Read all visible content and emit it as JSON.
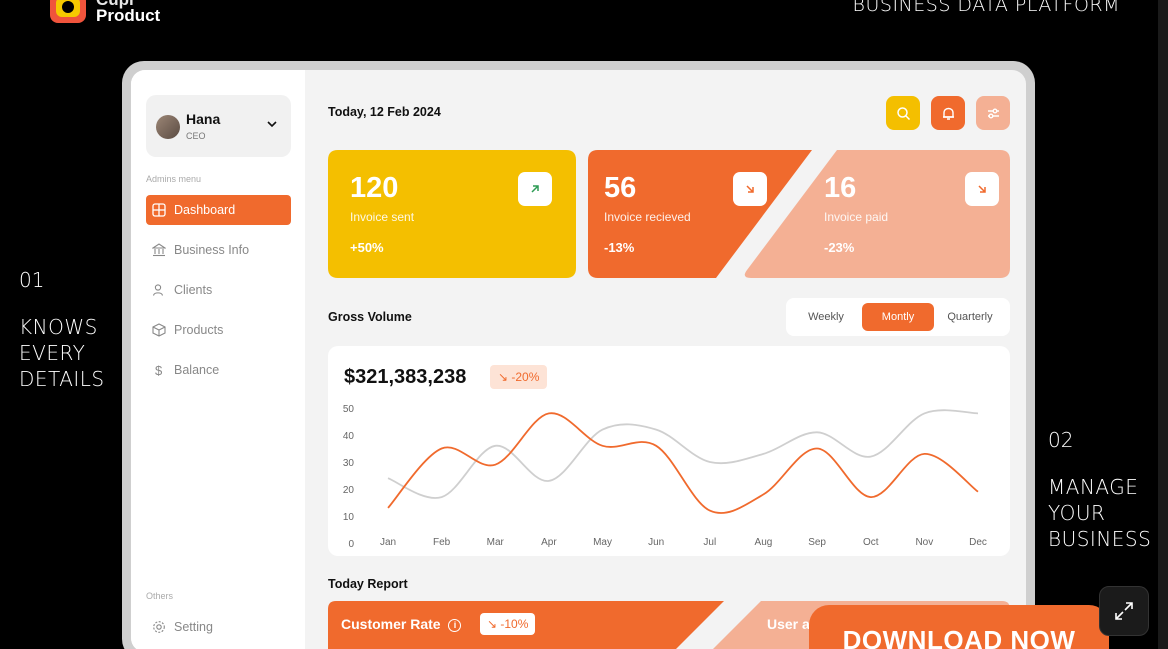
{
  "brand": {
    "name_top": "Cupi",
    "name_bottom": "Product"
  },
  "top_right_title": "BUSINESS DATA PLATFORM",
  "captions": {
    "left": {
      "num": "01",
      "lines": [
        "KNOWS",
        "EVERY",
        "DETAILS"
      ]
    },
    "right": {
      "num": "02",
      "lines": [
        "MANAGE",
        "YOUR",
        "BUSINESS"
      ]
    }
  },
  "user": {
    "name": "Hana",
    "role": "CEO"
  },
  "sidebar": {
    "menu_heading": "Admins menu",
    "items": [
      {
        "label": "Dashboard",
        "icon": "grid-icon",
        "active": true
      },
      {
        "label": "Business Info",
        "icon": "bank-icon"
      },
      {
        "label": "Clients",
        "icon": "users-icon"
      },
      {
        "label": "Products",
        "icon": "box-icon"
      },
      {
        "label": "Balance",
        "icon": "dollar-icon"
      }
    ],
    "others_heading": "Others",
    "setting_label": "Setting"
  },
  "header": {
    "date": "Today, 12 Feb 2024"
  },
  "stats": [
    {
      "value": "120",
      "label": "Invoice sent",
      "pct": "+50%",
      "color": "#f4bf00",
      "arrow": "up-right"
    },
    {
      "value": "56",
      "label": "Invoice recieved",
      "pct": "-13%",
      "color": "#f06a2d",
      "arrow": "down-right"
    },
    {
      "value": "16",
      "label": "Invoice paid",
      "pct": "-23%",
      "color": "#f4b094",
      "arrow": "down-right"
    }
  ],
  "gross": {
    "title": "Gross Volume",
    "tabs": [
      "Weekly",
      "Montly",
      "Quarterly"
    ],
    "active_tab": "Montly",
    "total": "$321,383,238",
    "delta": "↘ -20%"
  },
  "chart_data": {
    "type": "line",
    "categories": [
      "Jan",
      "Feb",
      "Mar",
      "Apr",
      "May",
      "Jun",
      "Jul",
      "Aug",
      "Sep",
      "Oct",
      "Nov",
      "Dec"
    ],
    "y_ticks": [
      0,
      10,
      20,
      30,
      40,
      50
    ],
    "ylim": [
      0,
      50
    ],
    "series": [
      {
        "color": "#f06a2d",
        "values": [
          13,
          35,
          29,
          48,
          36,
          36,
          12,
          18,
          35,
          17,
          33,
          19
        ]
      },
      {
        "color": "#cfcfcf",
        "values": [
          24,
          17,
          36,
          23,
          42,
          42,
          30,
          33,
          41,
          32,
          48,
          48
        ]
      }
    ]
  },
  "today_report": {
    "title": "Today Report",
    "customer_rate_label": "Customer Rate",
    "customer_rate_delta": "↘ -10%",
    "user_label": "User a"
  },
  "cta": {
    "label": "DOWNLOAD NOW"
  }
}
